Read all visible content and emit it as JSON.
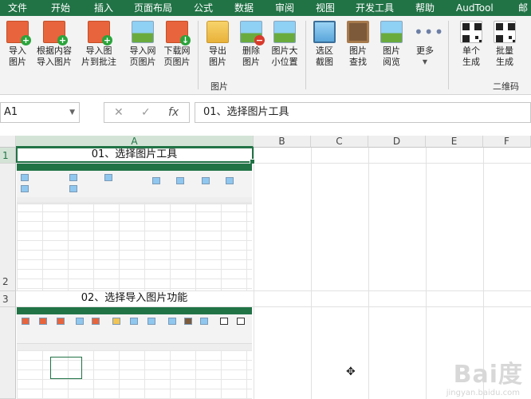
{
  "menu": {
    "tabs": [
      "文件",
      "开始",
      "插入",
      "页面布局",
      "公式",
      "数据",
      "审阅",
      "视图",
      "开发工具",
      "帮助",
      "AudTool",
      "邮"
    ]
  },
  "ribbon": {
    "buttons": [
      {
        "label": "导入\n图片",
        "icon": "image-add-icon"
      },
      {
        "label": "根据内容\n导入图片",
        "icon": "image-add-text-icon"
      },
      {
        "label": "导入图\n片到批注",
        "icon": "image-comment-icon"
      },
      {
        "label": "导入网\n页图片",
        "icon": "web-image-icon"
      },
      {
        "label": "下载网\n页图片",
        "icon": "download-image-icon"
      },
      {
        "label": "导出\n图片",
        "icon": "folder-export-icon"
      },
      {
        "label": "删除\n图片",
        "icon": "image-delete-icon"
      },
      {
        "label": "图片大\n小位置",
        "icon": "image-resize-icon"
      },
      {
        "label": "选区\n截图",
        "icon": "screenshot-icon"
      },
      {
        "label": "图片\n查找",
        "icon": "image-find-icon"
      },
      {
        "label": "图片\n阅览",
        "icon": "image-gallery-icon"
      },
      {
        "label": "更多",
        "icon": "more-dots-icon"
      },
      {
        "label": "单个\n生成",
        "icon": "qr-single-icon"
      },
      {
        "label": "批量\n生成",
        "icon": "qr-batch-icon"
      }
    ],
    "group_picture": "图片",
    "group_qrcode": "二维码"
  },
  "formula_bar": {
    "name_box": "A1",
    "cancel_icon": "✕",
    "confirm_icon": "✓",
    "fx_label": "fx",
    "value": "01、选择图片工具"
  },
  "sheet": {
    "columns": [
      "A",
      "B",
      "C",
      "D",
      "E",
      "F"
    ],
    "rows": [
      "1",
      "2",
      "3"
    ],
    "cells": {
      "a1": "01、选择图片工具",
      "a3": "02、选择导入图片功能"
    }
  },
  "watermark": {
    "text": "Bai度",
    "sub": "jingyan.baidu.com"
  },
  "colors": {
    "accent": "#217346"
  }
}
